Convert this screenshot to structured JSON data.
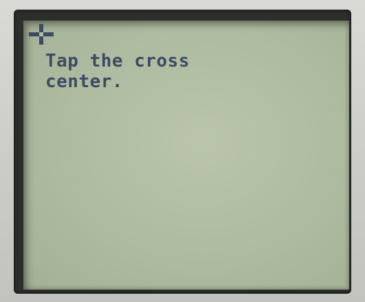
{
  "screen": {
    "instruction": "Tap the cross\ncenter.",
    "icons": {
      "calibration_target": "crosshair-icon"
    }
  },
  "colors": {
    "lcd_background": "#b0bda2",
    "lcd_text": "#3e4a63",
    "bezel": "#2b2e2b",
    "housing": "#cfd0cc"
  }
}
